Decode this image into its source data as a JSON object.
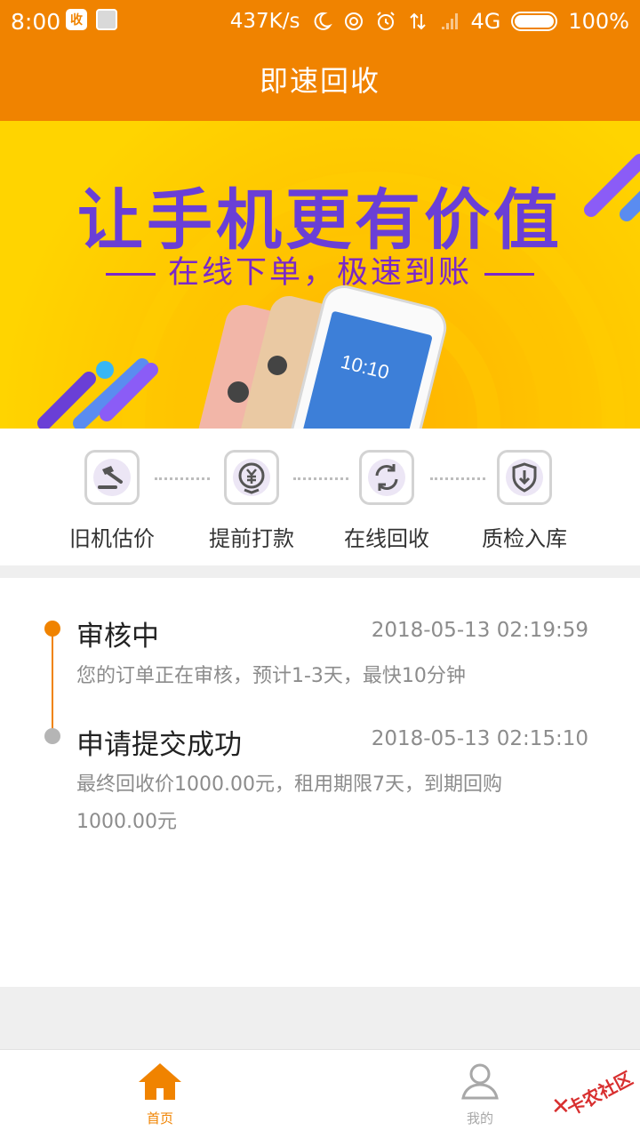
{
  "status_bar": {
    "time": "8:00",
    "app_badge": "收",
    "network_speed": "437K/s",
    "network": "4G",
    "battery": "100%"
  },
  "app_bar": {
    "title": "即速回收"
  },
  "banner": {
    "headline": "让手机更有价值",
    "subline": "在线下单，极速到账",
    "phone_screen_text": "10:10"
  },
  "steps": [
    {
      "label": "旧机估价",
      "icon": "gavel-icon"
    },
    {
      "label": "提前打款",
      "icon": "yuan-coin-icon"
    },
    {
      "label": "在线回收",
      "icon": "recycle-icon"
    },
    {
      "label": "质检入库",
      "icon": "shield-download-icon"
    }
  ],
  "timeline": [
    {
      "title": "审核中",
      "time": "2018-05-13 02:19:59",
      "desc": "您的订单正在审核，预计1-3天，最快10分钟",
      "status": "current"
    },
    {
      "title": "申请提交成功",
      "time": "2018-05-13 02:15:10",
      "desc": "最终回收价1000.00元，租用期限7天，到期回购1000.00元",
      "status": "done"
    }
  ],
  "bottom_nav": {
    "home_label": "首页",
    "mine_label": "我的"
  },
  "watermark": {
    "text": "卡农社区"
  },
  "colors": {
    "accent": "#f08300",
    "banner_bg": "#ffd400",
    "headline": "#6a3fd6",
    "timeline_inactive": "#b5b5b5"
  }
}
